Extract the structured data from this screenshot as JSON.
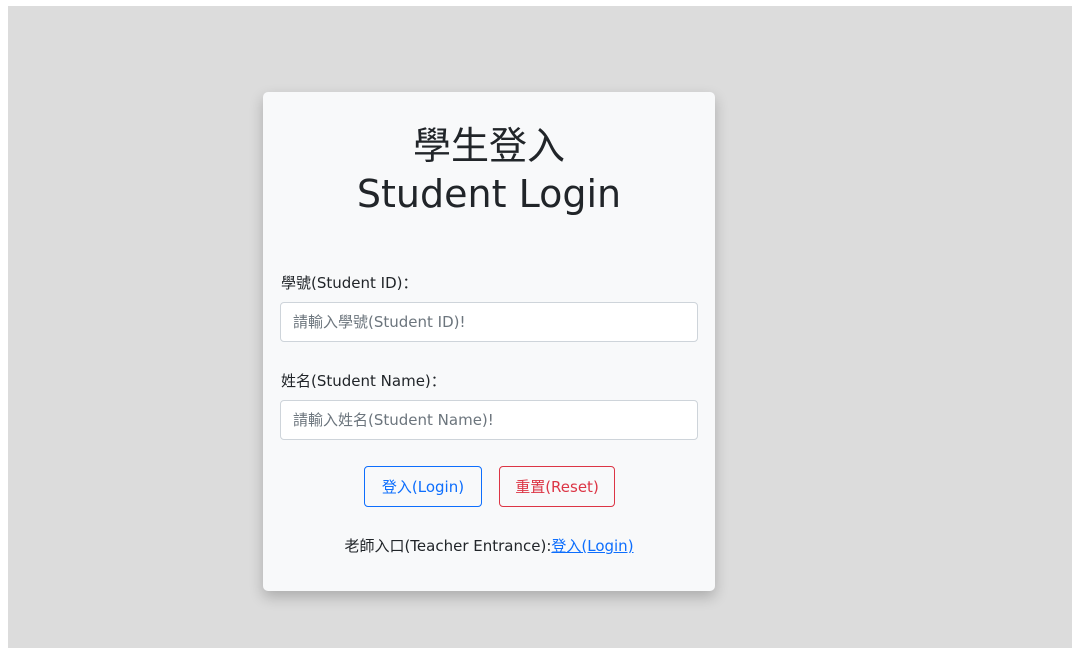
{
  "card": {
    "title_line1": "學生登入",
    "title_line2": "Student Login"
  },
  "student_id": {
    "label": "學號(Student ID)：",
    "placeholder": "請輸入學號(Student ID)!",
    "value": ""
  },
  "student_name": {
    "label": "姓名(Student Name)：",
    "placeholder": "請輸入姓名(Student Name)!",
    "value": ""
  },
  "buttons": {
    "login_label": "登入(Login)",
    "reset_label": "重置(Reset)"
  },
  "teacher": {
    "prefix": "老師入口(Teacher Entrance):",
    "link_label": "登入(Login)"
  },
  "colors": {
    "background": "#dcdcdc",
    "card": "#f8f9fa",
    "primary": "#0d6efd",
    "danger": "#dc3545"
  }
}
